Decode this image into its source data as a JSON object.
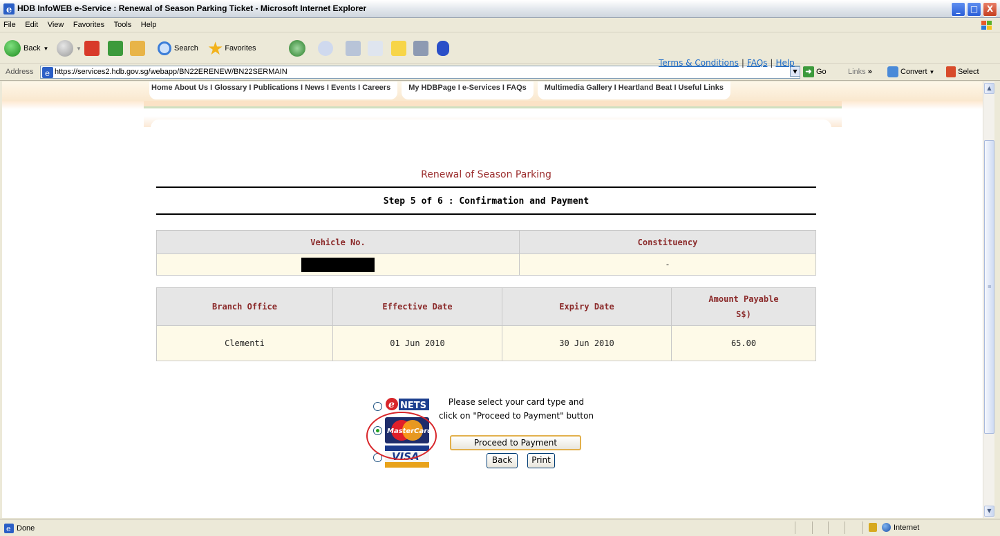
{
  "window": {
    "title": "HDB InfoWEB e-Service : Renewal of Season Parking Ticket - Microsoft Internet Explorer",
    "controls": [
      "_",
      "□",
      "X"
    ]
  },
  "menu": [
    "File",
    "Edit",
    "View",
    "Favorites",
    "Tools",
    "Help"
  ],
  "toolbar": {
    "back_label": "Back",
    "search_label": "Search",
    "favorites_label": "Favorites"
  },
  "address": {
    "label": "Address",
    "url": "https://services2.hdb.gov.sg/webapp/BN22ERENEW/BN22SERMAIN",
    "go_label": "Go",
    "links_label": "Links",
    "convert_label": "Convert",
    "select_label": "Select"
  },
  "site_nav": {
    "group1": "Home   About Us I Glossary I Publications I News I Events I Careers",
    "group2": "My HDBPage I e-Services I FAQs",
    "group3": "Multimedia Gallery I Heartland Beat I Useful Links"
  },
  "top_links": [
    "Terms & Conditions",
    "FAQs",
    "Help"
  ],
  "page": {
    "heading": "Renewal of Season Parking",
    "step": "Step 5 of 6 : Confirmation and Payment"
  },
  "vehicle_table": {
    "headers": [
      "Vehicle No.",
      "Constituency"
    ],
    "row": [
      "",
      "-"
    ]
  },
  "payment_table": {
    "headers": [
      "Branch Office",
      "Effective Date",
      "Expiry Date",
      "Amount Payable S$)"
    ],
    "row": [
      "Clementi",
      "01 Jun 2010",
      "30 Jun 2010",
      "65.00"
    ]
  },
  "payment": {
    "options": [
      "eNETS",
      "MasterCard",
      "VISA"
    ],
    "selected": "MasterCard",
    "instruction_line1": "Please select your card type and",
    "instruction_line2": "click on \"Proceed to Payment\" button",
    "proceed_label": "Proceed to Payment",
    "back_label": "Back",
    "print_label": "Print"
  },
  "status": {
    "text": "Done",
    "zone": "Internet"
  }
}
